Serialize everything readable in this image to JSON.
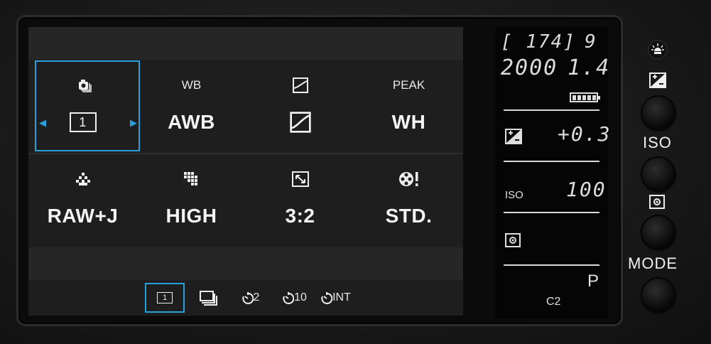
{
  "settings": {
    "drive": {
      "header_icon": "drive-mode-icon",
      "value": "1"
    },
    "wb": {
      "header": "WB",
      "value": "AWB"
    },
    "tone": {
      "header_icon": "tone-curve-icon",
      "value_icon": "tone-curve-icon"
    },
    "peak": {
      "header": "PEAK",
      "value": "WH"
    },
    "quality": {
      "header_icon": "image-quality-icon",
      "value": "RAW+J"
    },
    "size": {
      "header_icon": "image-size-icon",
      "value": "HIGH"
    },
    "aspect": {
      "header_icon": "aspect-ratio-icon",
      "value": "3:2"
    },
    "color": {
      "header_icon": "color-mode-icon",
      "value": "STD."
    }
  },
  "drive_bar": [
    {
      "name": "single",
      "label": "1",
      "selected": true
    },
    {
      "name": "continuous",
      "icon": "continuous-shooting-icon"
    },
    {
      "name": "timer-2",
      "label": "2"
    },
    {
      "name": "timer-10",
      "label": "10"
    },
    {
      "name": "interval",
      "label": "INT"
    }
  ],
  "lcd": {
    "shots_left": "[ 174]",
    "frame": "9",
    "shutter": "2000",
    "aperture": "1.4",
    "exposure_comp": "+0.3",
    "iso_label": "ISO",
    "iso_value": "100",
    "mode": "P",
    "custom": "C2"
  },
  "buttons": {
    "iso_label": "ISO",
    "mode_label": "MODE"
  },
  "colors": {
    "accent": "#27a0dc",
    "panel": "#1e1e1e",
    "lcd": "#050505"
  }
}
